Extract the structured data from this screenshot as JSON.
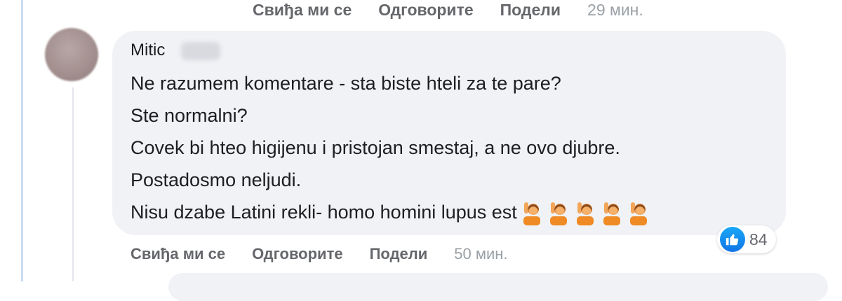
{
  "top_actions": {
    "like": "Свиђа ми се",
    "reply": "Одговорите",
    "share": "Подели",
    "time": "29 мин."
  },
  "comment": {
    "author": "Mitic",
    "lines": [
      "Ne razumem komentare - sta biste hteli za te pare?",
      "Ste normalni?",
      "Covek bi hteo higijenu i pristojan smestaj, a ne ovo djubre.",
      "Postadosmo neljudi.",
      "Nisu dzabe Latini rekli- homo homini lupus est"
    ],
    "emoji_icon": "person-raising-hand-icon",
    "emoji_count": 5,
    "reaction_icon": "like-icon",
    "reaction_count": "84"
  },
  "bottom_actions": {
    "like": "Свиђа ми се",
    "reply": "Одговорите",
    "share": "Подели",
    "time": "50 мин."
  },
  "colors": {
    "bubble": "#f0f2f5",
    "action_text": "#65676b",
    "like_blue": "#1877f2",
    "left_rule": "#c9dcf2"
  }
}
